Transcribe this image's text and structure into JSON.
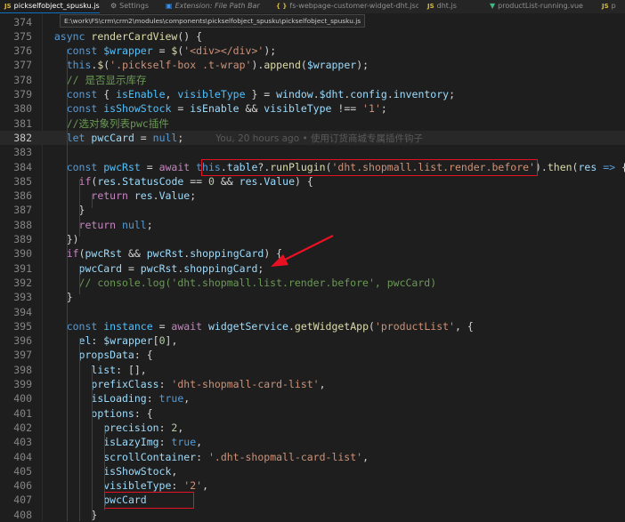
{
  "tabs": [
    {
      "icon": "JS",
      "label": "pickselfobject_spusku.js",
      "close": "✕",
      "active": true
    },
    {
      "icon": "⚙",
      "label": "Settings"
    },
    {
      "icon": "▣",
      "label": "Extension: File Path Bar",
      "italic": true
    },
    {
      "icon": "{ }",
      "label": "fs-webpage-customer-widget-dht.json"
    },
    {
      "icon": "JS",
      "label": "dht.js"
    },
    {
      "icon": "▼",
      "label": "productList-running.vue"
    },
    {
      "icon": "JS",
      "label": "p"
    }
  ],
  "path_tooltip": "E:\\work\\FS\\crm\\crm2\\modules\\components\\pickselfobject_spusku\\pickselfobject_spusku.js",
  "blame": "You, 20 hours ago • 使用订货商城专属插件钩子",
  "current_line": 382,
  "lines": [
    {
      "n": 374,
      "t": []
    },
    {
      "n": 375,
      "t": [
        [
          "",
          "  "
        ],
        [
          "k",
          "async "
        ],
        [
          "f",
          "renderCardView"
        ],
        [
          "p",
          "() {"
        ]
      ]
    },
    {
      "n": 376,
      "t": [
        [
          "",
          "    "
        ],
        [
          "k",
          "const "
        ],
        [
          "c",
          "$wrapper"
        ],
        [
          "p",
          " = "
        ],
        [
          "f",
          "$"
        ],
        [
          "p",
          "("
        ],
        [
          "s",
          "'<div></div>'"
        ],
        [
          "p",
          ");"
        ]
      ]
    },
    {
      "n": 377,
      "t": [
        [
          "",
          "    "
        ],
        [
          "k",
          "this"
        ],
        [
          "p",
          "."
        ],
        [
          "f",
          "$"
        ],
        [
          "p",
          "("
        ],
        [
          "s",
          "'.pickself-box .t-wrap'"
        ],
        [
          "p",
          ")."
        ],
        [
          "f",
          "append"
        ],
        [
          "p",
          "("
        ],
        [
          "v",
          "$wrapper"
        ],
        [
          "p",
          ");"
        ]
      ]
    },
    {
      "n": 378,
      "t": [
        [
          "",
          "    "
        ],
        [
          "cm",
          "// 是否显示库存"
        ]
      ]
    },
    {
      "n": 379,
      "t": [
        [
          "",
          "    "
        ],
        [
          "k",
          "const "
        ],
        [
          "p",
          "{ "
        ],
        [
          "c",
          "isEnable"
        ],
        [
          "p",
          ", "
        ],
        [
          "c",
          "visibleType"
        ],
        [
          "p",
          " } = "
        ],
        [
          "v",
          "window"
        ],
        [
          "p",
          "."
        ],
        [
          "v",
          "$dht"
        ],
        [
          "p",
          "."
        ],
        [
          "v",
          "config"
        ],
        [
          "p",
          "."
        ],
        [
          "v",
          "inventory"
        ],
        [
          "p",
          ";"
        ]
      ]
    },
    {
      "n": 380,
      "t": [
        [
          "",
          "    "
        ],
        [
          "k",
          "const "
        ],
        [
          "c",
          "isShowStock"
        ],
        [
          "p",
          " = "
        ],
        [
          "v",
          "isEnable"
        ],
        [
          "p",
          " && "
        ],
        [
          "v",
          "visibleType"
        ],
        [
          "p",
          " !== "
        ],
        [
          "s",
          "'1'"
        ],
        [
          "p",
          ";"
        ]
      ]
    },
    {
      "n": 381,
      "t": [
        [
          "",
          "    "
        ],
        [
          "cm",
          "//选对象列表pwc插件"
        ]
      ]
    },
    {
      "n": 382,
      "t": [
        [
          "",
          "    "
        ],
        [
          "k",
          "let "
        ],
        [
          "v",
          "pwcCard"
        ],
        [
          "p",
          " = "
        ],
        [
          "k",
          "null"
        ],
        [
          "p",
          ";"
        ]
      ],
      "blame": true
    },
    {
      "n": 383,
      "t": []
    },
    {
      "n": 384,
      "t": [
        [
          "",
          "    "
        ],
        [
          "k",
          "const "
        ],
        [
          "c",
          "pwcRst"
        ],
        [
          "p",
          " = "
        ],
        [
          "kc",
          "await "
        ],
        [
          "k",
          "this"
        ],
        [
          "p",
          "."
        ],
        [
          "v",
          "table"
        ],
        [
          "p",
          "?."
        ],
        [
          "f",
          "runPlugin"
        ],
        [
          "p",
          "("
        ],
        [
          "s",
          "'dht.shopmall.list.render.before'"
        ],
        [
          "p",
          ")."
        ],
        [
          "f",
          "then"
        ],
        [
          "p",
          "("
        ],
        [
          "v",
          "res"
        ],
        [
          "k",
          " => "
        ],
        [
          "p",
          "{"
        ]
      ]
    },
    {
      "n": 385,
      "t": [
        [
          "",
          "      "
        ],
        [
          "kc",
          "if"
        ],
        [
          "p",
          "("
        ],
        [
          "v",
          "res"
        ],
        [
          "p",
          "."
        ],
        [
          "v",
          "StatusCode"
        ],
        [
          "p",
          " == "
        ],
        [
          "n",
          "0"
        ],
        [
          "p",
          " && "
        ],
        [
          "v",
          "res"
        ],
        [
          "p",
          "."
        ],
        [
          "v",
          "Value"
        ],
        [
          "p",
          ") {"
        ]
      ]
    },
    {
      "n": 386,
      "t": [
        [
          "",
          "        "
        ],
        [
          "kc",
          "return "
        ],
        [
          "v",
          "res"
        ],
        [
          "p",
          "."
        ],
        [
          "v",
          "Value"
        ],
        [
          "p",
          ";"
        ]
      ]
    },
    {
      "n": 387,
      "t": [
        [
          "",
          "      "
        ],
        [
          "p",
          "}"
        ]
      ]
    },
    {
      "n": 388,
      "t": [
        [
          "",
          "      "
        ],
        [
          "kc",
          "return "
        ],
        [
          "k",
          "null"
        ],
        [
          "p",
          ";"
        ]
      ]
    },
    {
      "n": 389,
      "t": [
        [
          "",
          "    "
        ],
        [
          "p",
          "})"
        ]
      ]
    },
    {
      "n": 390,
      "t": [
        [
          "",
          "    "
        ],
        [
          "kc",
          "if"
        ],
        [
          "p",
          "("
        ],
        [
          "v",
          "pwcRst"
        ],
        [
          "p",
          " && "
        ],
        [
          "v",
          "pwcRst"
        ],
        [
          "p",
          "."
        ],
        [
          "v",
          "shoppingCard"
        ],
        [
          "p",
          ") {"
        ]
      ]
    },
    {
      "n": 391,
      "t": [
        [
          "",
          "      "
        ],
        [
          "v",
          "pwcCard"
        ],
        [
          "p",
          " = "
        ],
        [
          "v",
          "pwcRst"
        ],
        [
          "p",
          "."
        ],
        [
          "v",
          "shoppingCard"
        ],
        [
          "p",
          ";"
        ]
      ]
    },
    {
      "n": 392,
      "t": [
        [
          "",
          "      "
        ],
        [
          "cm",
          "// console.log('dht.shopmall.list.render.before', pwcCard)"
        ]
      ]
    },
    {
      "n": 393,
      "t": [
        [
          "",
          "    "
        ],
        [
          "p",
          "}"
        ]
      ]
    },
    {
      "n": 394,
      "t": []
    },
    {
      "n": 395,
      "t": [
        [
          "",
          "    "
        ],
        [
          "k",
          "const "
        ],
        [
          "c",
          "instance"
        ],
        [
          "p",
          " = "
        ],
        [
          "kc",
          "await "
        ],
        [
          "v",
          "widgetService"
        ],
        [
          "p",
          "."
        ],
        [
          "f",
          "getWidgetApp"
        ],
        [
          "p",
          "("
        ],
        [
          "s",
          "'productList'"
        ],
        [
          "p",
          ", {"
        ]
      ]
    },
    {
      "n": 396,
      "t": [
        [
          "",
          "      "
        ],
        [
          "v",
          "el"
        ],
        [
          "p",
          ": "
        ],
        [
          "v",
          "$wrapper"
        ],
        [
          "p",
          "["
        ],
        [
          "n",
          "0"
        ],
        [
          "p",
          "],"
        ]
      ]
    },
    {
      "n": 397,
      "t": [
        [
          "",
          "      "
        ],
        [
          "v",
          "propsData"
        ],
        [
          "p",
          ": {"
        ]
      ]
    },
    {
      "n": 398,
      "t": [
        [
          "",
          "        "
        ],
        [
          "v",
          "list"
        ],
        [
          "p",
          ": [],"
        ]
      ]
    },
    {
      "n": 399,
      "t": [
        [
          "",
          "        "
        ],
        [
          "v",
          "prefixClass"
        ],
        [
          "p",
          ": "
        ],
        [
          "s",
          "'dht-shopmall-card-list'"
        ],
        [
          "p",
          ","
        ]
      ]
    },
    {
      "n": 400,
      "t": [
        [
          "",
          "        "
        ],
        [
          "v",
          "isLoading"
        ],
        [
          "p",
          ": "
        ],
        [
          "k",
          "true"
        ],
        [
          "p",
          ","
        ]
      ]
    },
    {
      "n": 401,
      "t": [
        [
          "",
          "        "
        ],
        [
          "v",
          "options"
        ],
        [
          "p",
          ": {"
        ]
      ]
    },
    {
      "n": 402,
      "t": [
        [
          "",
          "          "
        ],
        [
          "v",
          "precision"
        ],
        [
          "p",
          ": "
        ],
        [
          "n",
          "2"
        ],
        [
          "p",
          ","
        ]
      ]
    },
    {
      "n": 403,
      "t": [
        [
          "",
          "          "
        ],
        [
          "v",
          "isLazyImg"
        ],
        [
          "p",
          ": "
        ],
        [
          "k",
          "true"
        ],
        [
          "p",
          ","
        ]
      ]
    },
    {
      "n": 404,
      "t": [
        [
          "",
          "          "
        ],
        [
          "v",
          "scrollContainer"
        ],
        [
          "p",
          ": "
        ],
        [
          "s",
          "'.dht-shopmall-card-list'"
        ],
        [
          "p",
          ","
        ]
      ]
    },
    {
      "n": 405,
      "t": [
        [
          "",
          "          "
        ],
        [
          "v",
          "isShowStock"
        ],
        [
          "p",
          ","
        ]
      ]
    },
    {
      "n": 406,
      "t": [
        [
          "",
          "          "
        ],
        [
          "v",
          "visibleType"
        ],
        [
          "p",
          ": "
        ],
        [
          "s",
          "'2'"
        ],
        [
          "p",
          ","
        ]
      ]
    },
    {
      "n": 407,
      "t": [
        [
          "",
          "          "
        ],
        [
          "v",
          "pwcCard"
        ]
      ]
    },
    {
      "n": 408,
      "t": [
        [
          "",
          "        "
        ],
        [
          "p",
          "}"
        ]
      ]
    }
  ],
  "annotation_color": "#e81123"
}
